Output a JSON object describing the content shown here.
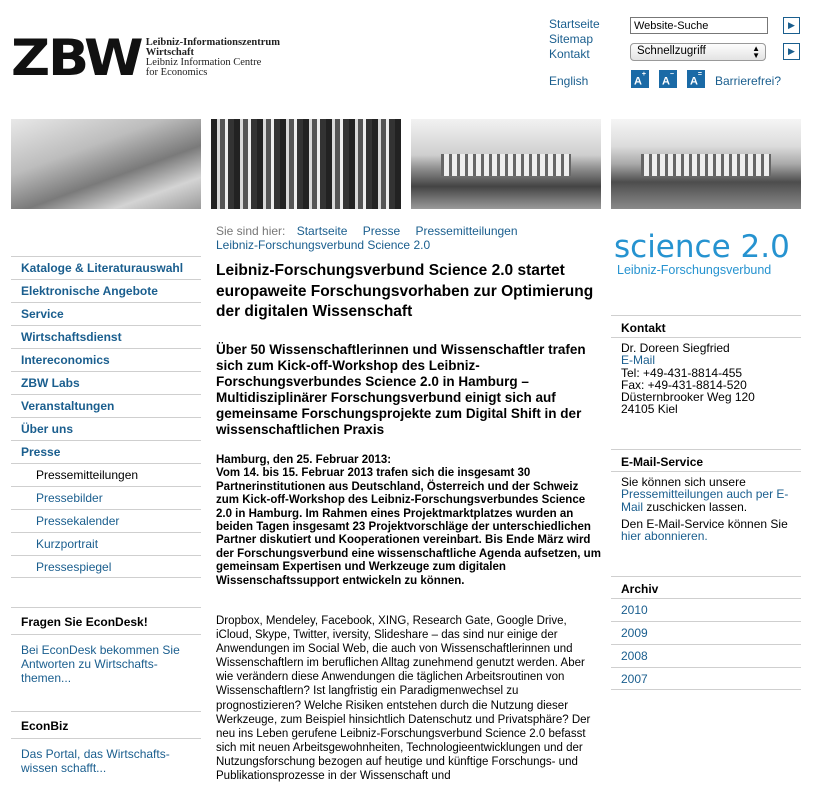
{
  "logo": {
    "mark": "ZBW",
    "line1": "Leibniz-Informationszentrum",
    "line2": "Wirtschaft",
    "line3": "Leibniz Information Centre",
    "line4": "for Economics"
  },
  "topnav": {
    "home": "Startseite",
    "sitemap": "Sitemap",
    "contact": "Kontakt",
    "english": "English"
  },
  "search": {
    "placeholder": "Website-Suche"
  },
  "quickaccess": {
    "value": "Schnellzugriff"
  },
  "font": {
    "larger": "A",
    "smaller": "A",
    "normal": "A",
    "accessible": "Barrierefrei?"
  },
  "leftnav": {
    "items": [
      "Kataloge & Literaturauswahl",
      "Elektronische Angebote",
      "Service",
      "Wirtschaftsdienst",
      "Intereconomics",
      "ZBW Labs",
      "Veranstaltungen",
      "Über uns",
      "Presse"
    ],
    "subitems": [
      "Pressemitteilungen",
      "Pressebilder",
      "Pressekalender",
      "Kurzportrait",
      "Pressespiegel"
    ]
  },
  "econdesk": {
    "title": "Fragen Sie EconDesk!",
    "text": "Bei EconDesk bekommen Sie Antworten zu Wirtschafts-themen..."
  },
  "econbiz": {
    "title": "EconBiz",
    "text": "Das Portal, das Wirtschafts-wissen schafft..."
  },
  "breadcrumb": {
    "label": "Sie sind hier:",
    "items": [
      "Startseite",
      "Presse",
      "Pressemitteilungen"
    ],
    "current": "Leibniz-Forschungsverbund Science 2.0"
  },
  "article": {
    "title": "Leibniz-Forschungsverbund Science 2.0 startet europaweite Forschungsvorhaben zur Optimierung der digitalen Wissenschaft",
    "subtitle": "Über 50 Wissenschaftlerinnen und Wissenschaftler trafen sich zum Kick-off-Workshop des Leibniz-Forschungsverbundes Science 2.0 in Hamburg – Multidisziplinärer Forschungsverbund einigt sich auf gemeinsame Forschungsprojekte zum Digital Shift in der wissenschaftlichen Praxis",
    "dateline": "Hamburg, den 25. Februar 2013:",
    "lead": "Vom 14. bis 15. Februar 2013 trafen sich die insgesamt 30 Partnerinstitutionen aus Deutschland, Österreich und der Schweiz zum Kick-off-Workshop des Leibniz-Forschungsverbundes Science 2.0 in Hamburg. Im Rahmen eines Projektmarktplatzes wurden an beiden Tagen insgesamt 23 Projektvorschläge der unterschiedlichen Partner diskutiert und Kooperationen vereinbart. Bis Ende März wird der Forschungsverbund eine wissenschaftliche Agenda aufsetzen, um gemeinsam Expertisen und Werkzeuge zum digitalen Wissenschaftssupport entwickeln zu können.",
    "body": "Dropbox, Mendeley, Facebook, XING, Research Gate, Google Drive, iCloud, Skype, Twitter, iversity, Slideshare – das sind nur einige der Anwendungen im Social Web, die auch von Wissenschaftlerinnen und Wissenschaftlern im beruflichen Alltag zunehmend genutzt werden. Aber wie verändern diese Anwendungen die täglichen Arbeitsroutinen von Wissenschaftlern? Ist langfristig ein Paradigmenwechsel zu prognostizieren? Welche Risiken entstehen durch die Nutzung dieser Werkzeuge, zum Beispiel hinsichtlich Datenschutz und Privatsphäre? Der neu ins Leben gerufene Leibniz-Forschungsverbund Science 2.0 befasst sich mit neuen Arbeitsgewohnheiten, Technologieentwicklungen und der Nutzungsforschung bezogen auf heutige und künftige Forschungs- und Publikationsprozesse in der Wissenschaft und"
  },
  "science": {
    "big": "science 2.0",
    "small": "Leibniz-Forschungsverbund"
  },
  "contact": {
    "title": "Kontakt",
    "name": "Dr. Doreen Siegfried",
    "email": "E-Mail",
    "tel": "Tel: +49-431-8814-455",
    "fax": "Fax: +49-431-8814-520",
    "street": "Düsternbrooker Weg 120",
    "city": "24105 Kiel"
  },
  "emailservice": {
    "title": "E-Mail-Service",
    "p1_pre": "Sie können sich unsere",
    "p1_link": "Pressemitteilungen auch per E-Mail",
    "p1_post": "zuschicken lassen.",
    "p2_pre": "Den E-Mail-Service können Sie",
    "p2_link": "hier abonnieren."
  },
  "archive": {
    "title": "Archiv",
    "years": [
      "2010",
      "2009",
      "2008",
      "2007"
    ]
  }
}
